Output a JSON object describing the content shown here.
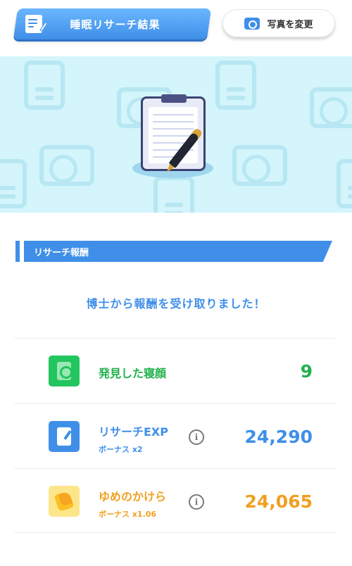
{
  "header": {
    "title": "睡眠リサーチ結果",
    "change_photo_label": "写真を変更"
  },
  "section": {
    "title": "リサーチ報酬",
    "message": "博士から報酬を受け取りました！"
  },
  "rewards": [
    {
      "label": "発見した寝顔",
      "value": "9",
      "icon": "sleep-face-icon",
      "color": "#22b14c"
    },
    {
      "label": "リサーチEXP",
      "sub": "ボーナス x2",
      "value": "24,290",
      "icon": "research-exp-icon",
      "color": "#3f8fe8"
    },
    {
      "label": "ゆめのかけら",
      "sub": "ボーナス x1.06",
      "value": "24,065",
      "icon": "dream-shard-icon",
      "color": "#f0a020"
    }
  ],
  "colors": {
    "accent_blue": "#3f8fe8",
    "banner_bg": "#d3f5fb",
    "green": "#22b14c",
    "orange": "#f0a020"
  }
}
